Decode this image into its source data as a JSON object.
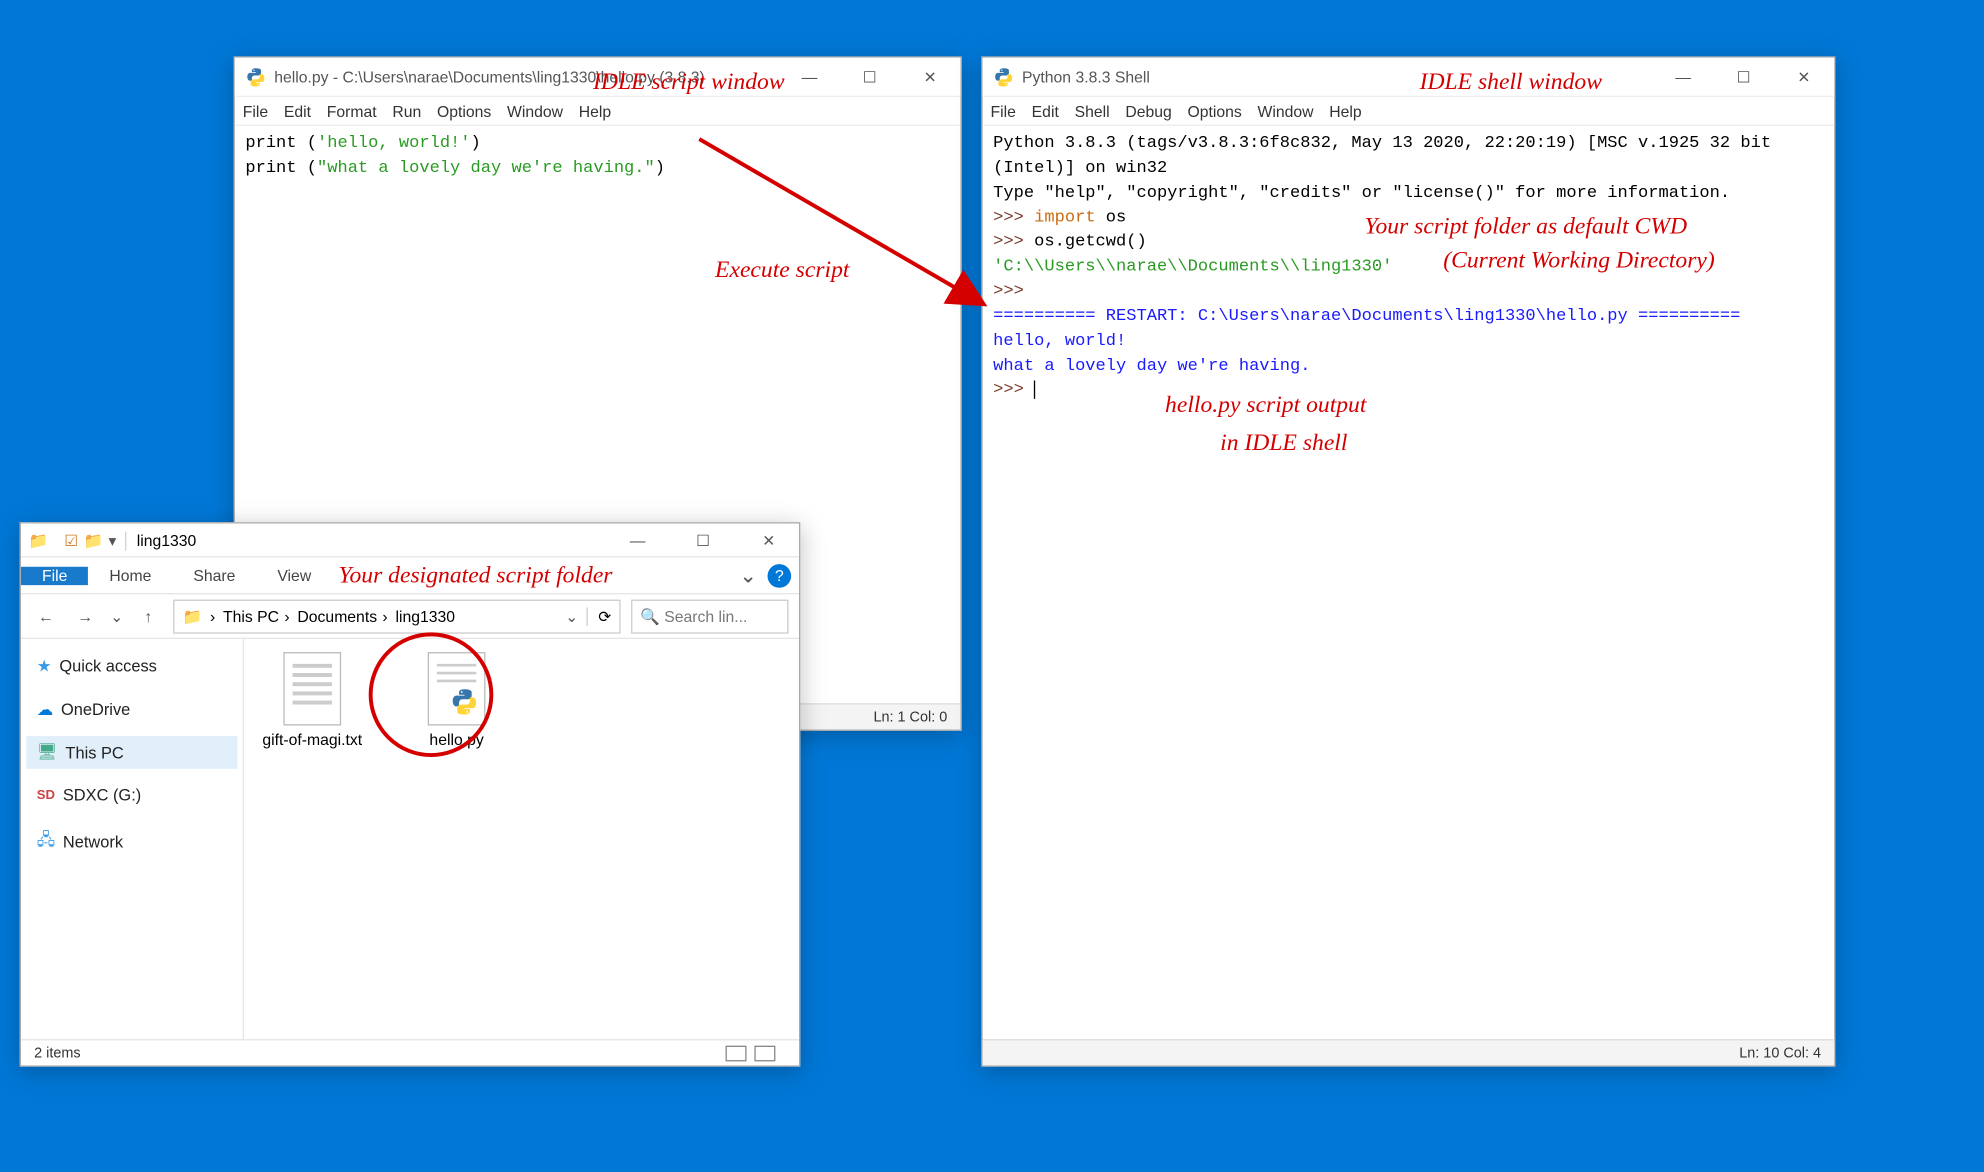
{
  "annotations": {
    "script_window": "IDLE script window",
    "shell_window": "IDLE shell window",
    "execute": "Execute script",
    "cwd_line1": "Your script folder as default CWD",
    "cwd_line2": "(Current Working Directory)",
    "output_line1": "hello.py script output",
    "output_line2": "in IDLE shell",
    "folder": "Your designated script folder"
  },
  "script_window": {
    "title": "hello.py - C:\\Users\\narae\\Documents\\ling1330\\hello.py (3.8.3)",
    "menus": [
      "File",
      "Edit",
      "Format",
      "Run",
      "Options",
      "Window",
      "Help"
    ],
    "code": {
      "l1_pre": "print (",
      "l1_str": "'hello, world!'",
      "l1_post": ")",
      "l2_pre": "print (",
      "l2_str": "\"what a lovely day we're having.\"",
      "l2_post": ")"
    },
    "status": "Ln: 1  Col: 0"
  },
  "shell_window": {
    "title": "Python 3.8.3 Shell",
    "menus": [
      "File",
      "Edit",
      "Shell",
      "Debug",
      "Options",
      "Window",
      "Help"
    ],
    "banner1": "Python 3.8.3 (tags/v3.8.3:6f8c832, May 13 2020, 22:20:19) [MSC v.1925 32 bit (Intel)] on win32",
    "banner2": "Type \"help\", \"copyright\", \"credits\" or \"license()\" for more information.",
    "prompt": ">>> ",
    "import_kw": "import",
    "import_mod": " os",
    "getcwd": "os.getcwd()",
    "cwd_result": "'C:\\\\Users\\\\narae\\\\Documents\\\\ling1330'",
    "restart": "========== RESTART: C:\\Users\\narae\\Documents\\ling1330\\hello.py ==========",
    "out1": "hello, world!",
    "out2": "what a lovely day we're having.",
    "status": "Ln: 10  Col: 4"
  },
  "explorer": {
    "tabtitle": "ling1330",
    "ribbon": [
      "File",
      "Home",
      "Share",
      "View"
    ],
    "breadcrumbs": [
      "This PC",
      "Documents",
      "ling1330"
    ],
    "search_placeholder": "Search lin...",
    "nav": [
      {
        "label": "Quick access",
        "icon": "star"
      },
      {
        "label": "OneDrive",
        "icon": "cloud"
      },
      {
        "label": "This PC",
        "icon": "pc",
        "selected": true
      },
      {
        "label": "SDXC (G:)",
        "icon": "sd"
      },
      {
        "label": "Network",
        "icon": "net"
      }
    ],
    "files": [
      {
        "name": "gift-of-magi.txt",
        "type": "txt"
      },
      {
        "name": "hello.py",
        "type": "py"
      }
    ],
    "status": "2 items"
  }
}
